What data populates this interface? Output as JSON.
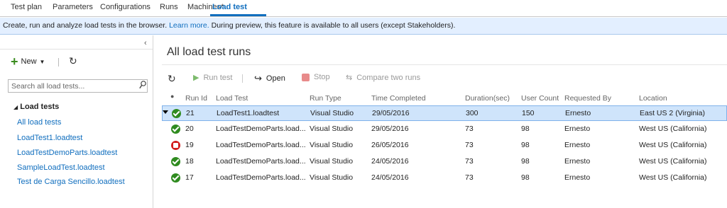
{
  "tabs": [
    "Test plan",
    "Parameters",
    "Configurations",
    "Runs",
    "Machines*",
    "Load test"
  ],
  "banner": {
    "text1": "Create, run and analyze load tests in the browser.",
    "link": "Learn more.",
    "text2": " During preview, this feature is available to all users (except Stakeholders)."
  },
  "sidebar": {
    "new_label": "New",
    "search_placeholder": "Search all load tests...",
    "tree_title": "Load tests",
    "items": [
      "All load tests",
      "LoadTest1.loadtest",
      "LoadTestDemoParts.loadtest",
      "SampleLoadTest.loadtest",
      "Test de Carga Sencillo.loadtest"
    ]
  },
  "main": {
    "title": "All load test runs",
    "toolbar": {
      "run": "Run test",
      "open": "Open",
      "stop": "Stop",
      "compare": "Compare two runs"
    },
    "columns": [
      "Run Id",
      "Load Test",
      "Run Type",
      "Time Completed",
      "Duration(sec)",
      "User Count",
      "Requested By",
      "Location"
    ],
    "rows": [
      {
        "status": "ok",
        "id": "21",
        "test": "LoadTest1.loadtest",
        "type": "Visual Studio",
        "time": "29/05/2016",
        "duration": "300",
        "users": "150",
        "by": "Ernesto",
        "location": "East US 2 (Virginia)",
        "selected": true
      },
      {
        "status": "ok",
        "id": "20",
        "test": "LoadTestDemoParts.load...",
        "type": "Visual Studio",
        "time": "29/05/2016",
        "duration": "73",
        "users": "98",
        "by": "Ernesto",
        "location": "West US (California)",
        "selected": false
      },
      {
        "status": "fail",
        "id": "19",
        "test": "LoadTestDemoParts.load...",
        "type": "Visual Studio",
        "time": "26/05/2016",
        "duration": "73",
        "users": "98",
        "by": "Ernesto",
        "location": "West US (California)",
        "selected": false
      },
      {
        "status": "ok",
        "id": "18",
        "test": "LoadTestDemoParts.load...",
        "type": "Visual Studio",
        "time": "24/05/2016",
        "duration": "73",
        "users": "98",
        "by": "Ernesto",
        "location": "West US (California)",
        "selected": false
      },
      {
        "status": "ok",
        "id": "17",
        "test": "LoadTestDemoParts.load...",
        "type": "Visual Studio",
        "time": "24/05/2016",
        "duration": "73",
        "users": "98",
        "by": "Ernesto",
        "location": "West US (California)",
        "selected": false
      }
    ]
  },
  "colors": {
    "accent": "#106ebe",
    "ok": "#2f8b1f",
    "fail": "#d21c1c",
    "selected": "#cfe4fb"
  }
}
